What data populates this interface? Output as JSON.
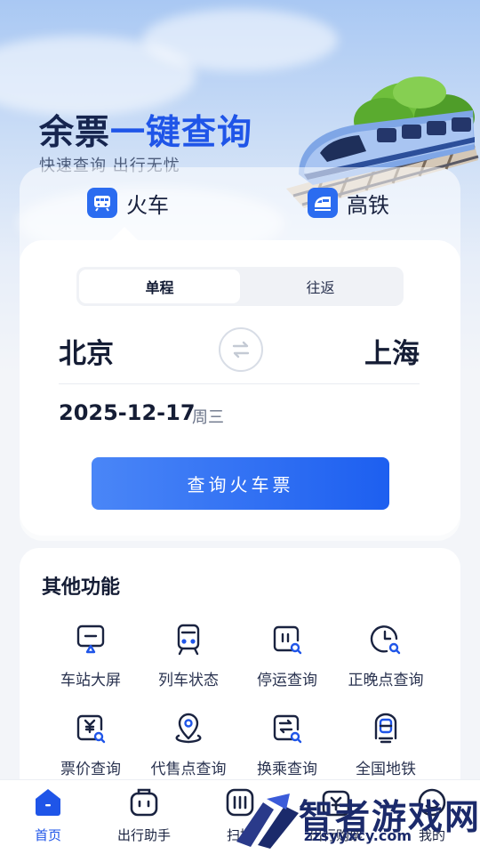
{
  "hero": {
    "title_a": "余票",
    "title_b": "一键查询",
    "subtitle": "快速查询 出行无忧"
  },
  "tabs": [
    {
      "label": "火车",
      "icon": "train-icon",
      "active": true
    },
    {
      "label": "高铁",
      "icon": "high-speed-rail-icon",
      "active": false
    }
  ],
  "trip_type": {
    "options": [
      "单程",
      "往返"
    ],
    "selected": "单程"
  },
  "route": {
    "from": "北京",
    "to": "上海",
    "swap_icon": "swap-icon"
  },
  "date": {
    "value": "2025-12-17",
    "weekday": "周三"
  },
  "query_button": "查询火车票",
  "functions": {
    "title": "其他功能",
    "items": [
      {
        "label": "车站大屏",
        "icon": "station-screen-icon"
      },
      {
        "label": "列车状态",
        "icon": "train-status-icon"
      },
      {
        "label": "停运查询",
        "icon": "suspension-query-icon"
      },
      {
        "label": "正晚点查询",
        "icon": "delay-query-icon"
      },
      {
        "label": "票价查询",
        "icon": "fare-query-icon"
      },
      {
        "label": "代售点查询",
        "icon": "agency-location-icon"
      },
      {
        "label": "换乘查询",
        "icon": "transfer-query-icon"
      },
      {
        "label": "全国地铁",
        "icon": "metro-icon"
      }
    ]
  },
  "bottom_nav": [
    {
      "label": "首页",
      "icon": "home-icon",
      "active": true
    },
    {
      "label": "出行助手",
      "icon": "luggage-icon",
      "active": false
    },
    {
      "label": "扫描",
      "icon": "scan-icon",
      "active": false
    },
    {
      "label": "出行购票",
      "icon": "ticket-icon",
      "active": false
    },
    {
      "label": "我的",
      "icon": "profile-icon",
      "active": false
    }
  ],
  "watermark": {
    "text": "智者游戏网",
    "url": "zzsyyxcy.com"
  },
  "colors": {
    "accent": "#1f55e8",
    "title_dark": "#16254f",
    "button_start": "#4a86f7",
    "button_end": "#1d5ff0"
  }
}
